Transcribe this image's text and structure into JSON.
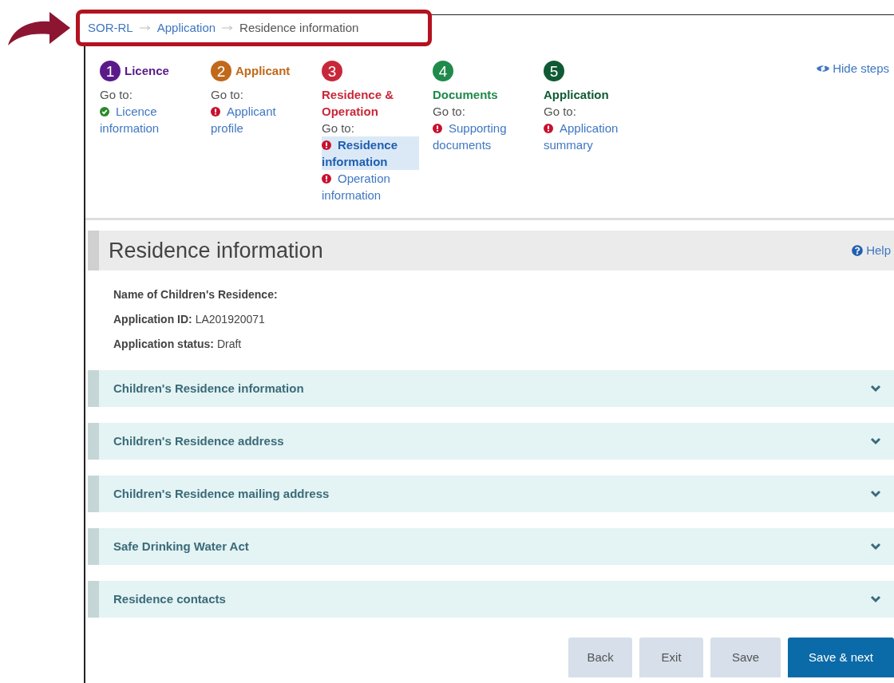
{
  "breadcrumb": {
    "items": [
      {
        "label": "SOR-RL",
        "kind": "link"
      },
      {
        "label": "Application",
        "kind": "link"
      },
      {
        "label": "Residence information",
        "kind": "current"
      }
    ]
  },
  "steps": [
    {
      "number": "1",
      "title": "Licence",
      "color": "#5b1a8a",
      "kind": "inline",
      "goto": "Go to:",
      "links": [
        {
          "label": "Licence information",
          "kind": "ok",
          "selected": false
        }
      ]
    },
    {
      "number": "2",
      "title": "Applicant",
      "color": "#c0691a",
      "kind": "inline",
      "goto": "Go to:",
      "links": [
        {
          "label": "Applicant profile",
          "kind": "error",
          "selected": false
        }
      ]
    },
    {
      "number": "3",
      "title": "Residence & Operation",
      "color": "#c8283a",
      "kind": "stacked",
      "goto": "Go to:",
      "links": [
        {
          "label": "Residence information",
          "kind": "error",
          "selected": true
        },
        {
          "label": "Operation information",
          "kind": "error",
          "selected": false
        }
      ]
    },
    {
      "number": "4",
      "title": "Documents",
      "color": "#1f8a4c",
      "kind": "stacked",
      "goto": "Go to:",
      "links": [
        {
          "label": "Supporting documents",
          "kind": "error",
          "selected": false
        }
      ]
    },
    {
      "number": "5",
      "title": "Application",
      "color": "#0f5a34",
      "kind": "stacked",
      "goto": "Go to:",
      "links": [
        {
          "label": "Application summary",
          "kind": "error",
          "selected": false
        }
      ]
    }
  ],
  "hide_steps": "Hide steps",
  "page_title": "Residence information",
  "help": "Help",
  "info": [
    {
      "label": "Name of Children's Residence:"
    },
    {
      "label": "Application ID:",
      "value": "LA201920071"
    },
    {
      "label": "Application status:",
      "value": "Draft"
    }
  ],
  "sections": [
    {
      "title": "Children's Residence information",
      "expanded": false
    },
    {
      "title": "Children's Residence address",
      "expanded": false
    },
    {
      "title": "Children's Residence mailing address",
      "expanded": false
    },
    {
      "title": "Safe Drinking Water Act",
      "expanded": false
    },
    {
      "title": "Residence contacts",
      "expanded": false
    }
  ],
  "buttons": [
    {
      "label": "Back",
      "kind": "secondary"
    },
    {
      "label": "Exit",
      "kind": "secondary"
    },
    {
      "label": "Save",
      "kind": "secondary"
    },
    {
      "label": "Save & next",
      "kind": "primary"
    }
  ]
}
